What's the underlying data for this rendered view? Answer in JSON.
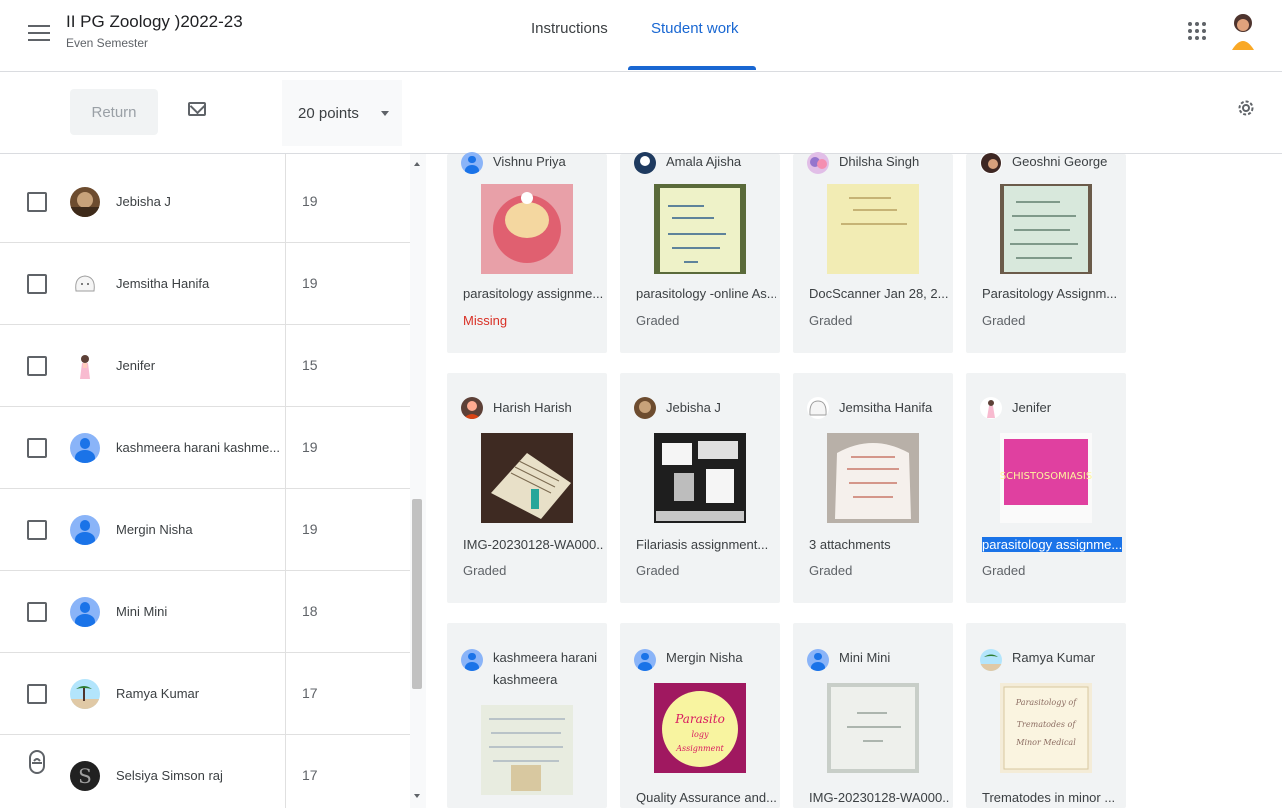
{
  "header": {
    "class_title": "II PG Zoology )2022-23",
    "class_subtitle": "Even Semester",
    "tabs": [
      {
        "label": "Instructions",
        "active": false
      },
      {
        "label": "Student work",
        "active": true
      }
    ]
  },
  "toolbar": {
    "return_label": "Return",
    "points_label": "20 points"
  },
  "students": [
    {
      "name": "Jebisha J",
      "grade": "19",
      "avatar": "photo-brown"
    },
    {
      "name": "Jemsitha Hanifa",
      "grade": "19",
      "avatar": "cartoon"
    },
    {
      "name": "Jenifer",
      "grade": "15",
      "avatar": "girl-figure"
    },
    {
      "name": "kashmeera harani kashme...",
      "grade": "19",
      "avatar": "default-person"
    },
    {
      "name": "Mergin Nisha",
      "grade": "19",
      "avatar": "default-person"
    },
    {
      "name": "Mini Mini",
      "grade": "18",
      "avatar": "default-person"
    },
    {
      "name": "Ramya Kumar",
      "grade": "17",
      "avatar": "photo-beach"
    },
    {
      "name": "Selsiya Simson raj",
      "grade": "17",
      "avatar": "letter-s"
    }
  ],
  "cards": [
    {
      "name": "Vishnu Priya",
      "file": "parasitology assignme...",
      "status": "Missing"
    },
    {
      "name": "Amala Ajisha",
      "file": "parasitology -online As...",
      "status": "Graded"
    },
    {
      "name": "Dhilsha Singh",
      "file": "DocScanner Jan 28, 2...",
      "status": "Graded"
    },
    {
      "name": "Geoshni George",
      "file": "Parasitology Assignm...",
      "status": "Graded"
    },
    {
      "name": "Harish Harish",
      "file": "IMG-20230128-WA000...",
      "status": "Graded"
    },
    {
      "name": "Jebisha J",
      "file": "Filariasis assignment...",
      "status": "Graded"
    },
    {
      "name": "Jemsitha Hanifa",
      "file": "3 attachments",
      "status": "Graded"
    },
    {
      "name": "Jenifer",
      "file": "parasitology assignme...",
      "status": "Graded"
    },
    {
      "name": "kashmeera harani kashmeera",
      "file": "",
      "status": ""
    },
    {
      "name": "Mergin Nisha",
      "file": "Quality Assurance and...",
      "status": ""
    },
    {
      "name": "Mini Mini",
      "file": "IMG-20230128-WA000...",
      "status": ""
    },
    {
      "name": "Ramya Kumar",
      "file": "Trematodes in minor ...",
      "status": ""
    }
  ],
  "thumbnail_text": {
    "card_2": "MICROSCOPICAL EXAMINATION OF URINE, SPUTUM AND BODY FLUIDS",
    "card_8": "SCHISTOSOMIASIS",
    "card_10": "Parasitology Assignment",
    "card_12": "Parasitology of Trematodes of Minor Medical"
  },
  "colors": {
    "accent": "#1967d2",
    "missing": "#d93025",
    "selection": "#1a73e8"
  }
}
